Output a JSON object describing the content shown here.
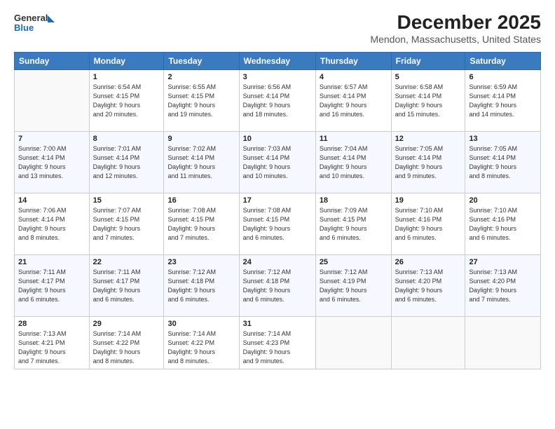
{
  "header": {
    "logo_line1": "General",
    "logo_line2": "Blue",
    "title": "December 2025",
    "subtitle": "Mendon, Massachusetts, United States"
  },
  "days_of_week": [
    "Sunday",
    "Monday",
    "Tuesday",
    "Wednesday",
    "Thursday",
    "Friday",
    "Saturday"
  ],
  "weeks": [
    [
      {
        "num": "",
        "info": ""
      },
      {
        "num": "1",
        "info": "Sunrise: 6:54 AM\nSunset: 4:15 PM\nDaylight: 9 hours\nand 20 minutes."
      },
      {
        "num": "2",
        "info": "Sunrise: 6:55 AM\nSunset: 4:15 PM\nDaylight: 9 hours\nand 19 minutes."
      },
      {
        "num": "3",
        "info": "Sunrise: 6:56 AM\nSunset: 4:14 PM\nDaylight: 9 hours\nand 18 minutes."
      },
      {
        "num": "4",
        "info": "Sunrise: 6:57 AM\nSunset: 4:14 PM\nDaylight: 9 hours\nand 16 minutes."
      },
      {
        "num": "5",
        "info": "Sunrise: 6:58 AM\nSunset: 4:14 PM\nDaylight: 9 hours\nand 15 minutes."
      },
      {
        "num": "6",
        "info": "Sunrise: 6:59 AM\nSunset: 4:14 PM\nDaylight: 9 hours\nand 14 minutes."
      }
    ],
    [
      {
        "num": "7",
        "info": "Sunrise: 7:00 AM\nSunset: 4:14 PM\nDaylight: 9 hours\nand 13 minutes."
      },
      {
        "num": "8",
        "info": "Sunrise: 7:01 AM\nSunset: 4:14 PM\nDaylight: 9 hours\nand 12 minutes."
      },
      {
        "num": "9",
        "info": "Sunrise: 7:02 AM\nSunset: 4:14 PM\nDaylight: 9 hours\nand 11 minutes."
      },
      {
        "num": "10",
        "info": "Sunrise: 7:03 AM\nSunset: 4:14 PM\nDaylight: 9 hours\nand 10 minutes."
      },
      {
        "num": "11",
        "info": "Sunrise: 7:04 AM\nSunset: 4:14 PM\nDaylight: 9 hours\nand 10 minutes."
      },
      {
        "num": "12",
        "info": "Sunrise: 7:05 AM\nSunset: 4:14 PM\nDaylight: 9 hours\nand 9 minutes."
      },
      {
        "num": "13",
        "info": "Sunrise: 7:05 AM\nSunset: 4:14 PM\nDaylight: 9 hours\nand 8 minutes."
      }
    ],
    [
      {
        "num": "14",
        "info": "Sunrise: 7:06 AM\nSunset: 4:14 PM\nDaylight: 9 hours\nand 8 minutes."
      },
      {
        "num": "15",
        "info": "Sunrise: 7:07 AM\nSunset: 4:15 PM\nDaylight: 9 hours\nand 7 minutes."
      },
      {
        "num": "16",
        "info": "Sunrise: 7:08 AM\nSunset: 4:15 PM\nDaylight: 9 hours\nand 7 minutes."
      },
      {
        "num": "17",
        "info": "Sunrise: 7:08 AM\nSunset: 4:15 PM\nDaylight: 9 hours\nand 6 minutes."
      },
      {
        "num": "18",
        "info": "Sunrise: 7:09 AM\nSunset: 4:15 PM\nDaylight: 9 hours\nand 6 minutes."
      },
      {
        "num": "19",
        "info": "Sunrise: 7:10 AM\nSunset: 4:16 PM\nDaylight: 9 hours\nand 6 minutes."
      },
      {
        "num": "20",
        "info": "Sunrise: 7:10 AM\nSunset: 4:16 PM\nDaylight: 9 hours\nand 6 minutes."
      }
    ],
    [
      {
        "num": "21",
        "info": "Sunrise: 7:11 AM\nSunset: 4:17 PM\nDaylight: 9 hours\nand 6 minutes."
      },
      {
        "num": "22",
        "info": "Sunrise: 7:11 AM\nSunset: 4:17 PM\nDaylight: 9 hours\nand 6 minutes."
      },
      {
        "num": "23",
        "info": "Sunrise: 7:12 AM\nSunset: 4:18 PM\nDaylight: 9 hours\nand 6 minutes."
      },
      {
        "num": "24",
        "info": "Sunrise: 7:12 AM\nSunset: 4:18 PM\nDaylight: 9 hours\nand 6 minutes."
      },
      {
        "num": "25",
        "info": "Sunrise: 7:12 AM\nSunset: 4:19 PM\nDaylight: 9 hours\nand 6 minutes."
      },
      {
        "num": "26",
        "info": "Sunrise: 7:13 AM\nSunset: 4:20 PM\nDaylight: 9 hours\nand 6 minutes."
      },
      {
        "num": "27",
        "info": "Sunrise: 7:13 AM\nSunset: 4:20 PM\nDaylight: 9 hours\nand 7 minutes."
      }
    ],
    [
      {
        "num": "28",
        "info": "Sunrise: 7:13 AM\nSunset: 4:21 PM\nDaylight: 9 hours\nand 7 minutes."
      },
      {
        "num": "29",
        "info": "Sunrise: 7:14 AM\nSunset: 4:22 PM\nDaylight: 9 hours\nand 8 minutes."
      },
      {
        "num": "30",
        "info": "Sunrise: 7:14 AM\nSunset: 4:22 PM\nDaylight: 9 hours\nand 8 minutes."
      },
      {
        "num": "31",
        "info": "Sunrise: 7:14 AM\nSunset: 4:23 PM\nDaylight: 9 hours\nand 9 minutes."
      },
      {
        "num": "",
        "info": ""
      },
      {
        "num": "",
        "info": ""
      },
      {
        "num": "",
        "info": ""
      }
    ]
  ]
}
